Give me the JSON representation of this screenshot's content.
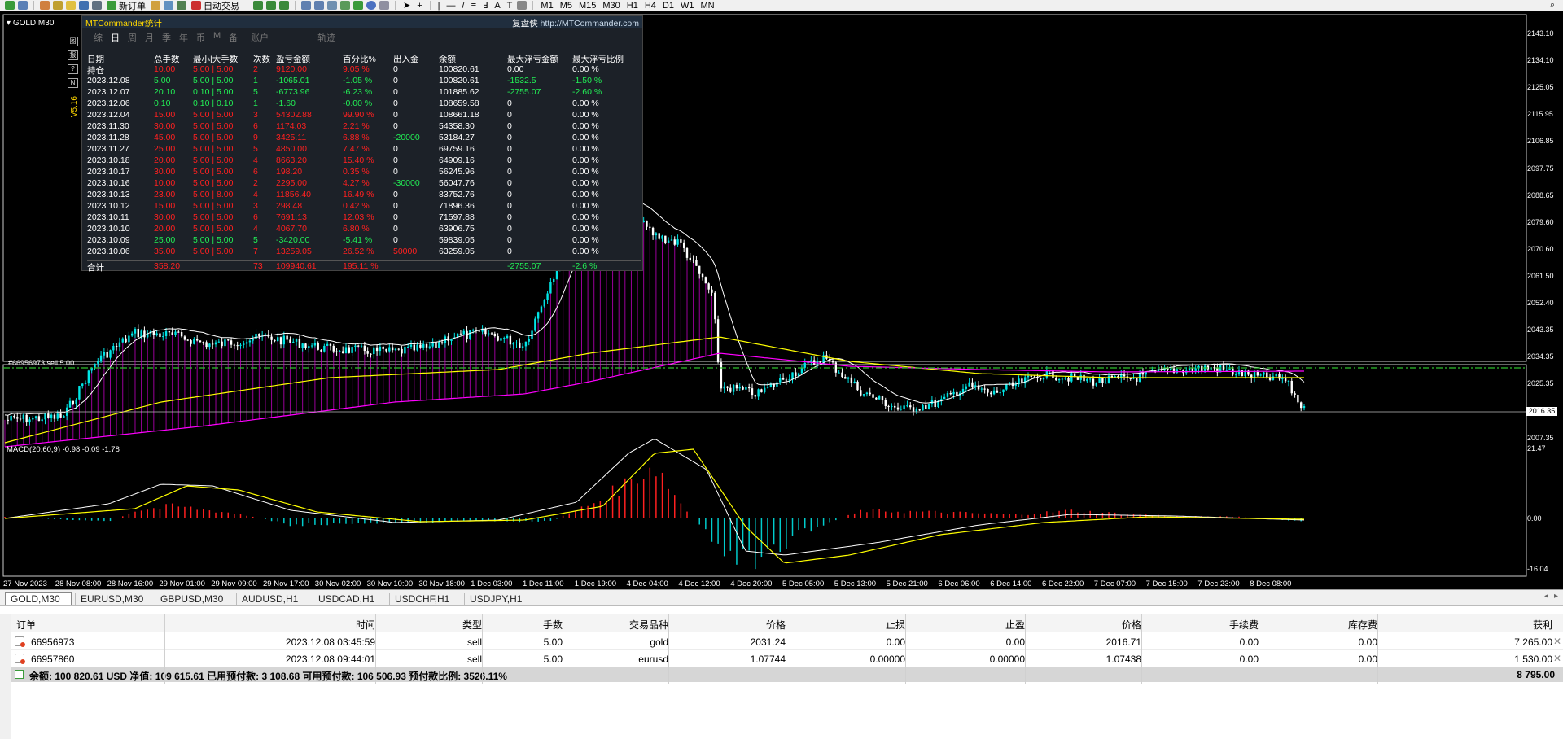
{
  "toolbar": {
    "new_order": "新订单",
    "auto_trade": "自动交易",
    "timeframes": [
      "M1",
      "M5",
      "M15",
      "M30",
      "H1",
      "H4",
      "D1",
      "W1",
      "MN"
    ]
  },
  "chart": {
    "symbol_label": "GOLD,M30",
    "order_line_label": "#66956973 sell 5.00",
    "macd_label": "MACD(20,60,9) -0.98 -0.09 -1.78",
    "price_axis": [
      "2143.10",
      "2134.10",
      "2125.05",
      "2115.95",
      "2106.85",
      "2097.75",
      "2088.65",
      "2079.60",
      "2070.60",
      "2061.50",
      "2052.40",
      "2043.35",
      "2034.35",
      "2025.35",
      "2016.35",
      "2007.35"
    ],
    "current_price": "2016.35",
    "macd_axis": [
      "21.47",
      "0.00",
      "-16.04"
    ],
    "time_axis": [
      "27 Nov 2023",
      "28 Nov 08:00",
      "28 Nov 16:00",
      "29 Nov 01:00",
      "29 Nov 09:00",
      "29 Nov 17:00",
      "30 Nov 02:00",
      "30 Nov 10:00",
      "30 Nov 18:00",
      "1 Dec 03:00",
      "1 Dec 11:00",
      "1 Dec 19:00",
      "4 Dec 04:00",
      "4 Dec 12:00",
      "4 Dec 20:00",
      "5 Dec 05:00",
      "5 Dec 13:00",
      "5 Dec 21:00",
      "6 Dec 06:00",
      "6 Dec 14:00",
      "6 Dec 22:00",
      "7 Dec 07:00",
      "7 Dec 15:00",
      "7 Dec 23:00",
      "8 Dec 08:00"
    ],
    "version": "V5.16",
    "side_buttons": [
      "图",
      "报",
      "?",
      "N"
    ],
    "colors": {
      "bg": "#000000",
      "bull": "#00e5e5",
      "bear": "#ffffff",
      "ma_fast": "#ffffff",
      "ma_slow": "#ffff00",
      "band": "#ff00ff",
      "order_line": "#2fbf2f",
      "macd_pos": "#ff2020",
      "macd_neg": "#00cccc"
    }
  },
  "stats": {
    "title": "MTCommander统计",
    "link_prefix": "复盘侠",
    "link": "http://MTCommander.com",
    "periods": [
      "综",
      "日",
      "周",
      "月",
      "季",
      "年",
      "币",
      "M",
      "备",
      "账户",
      "轨迹"
    ],
    "headers": [
      "日期",
      "总手数",
      "最小|大手数",
      "次数",
      "盈亏金额",
      "百分比%",
      "出入金",
      "余额",
      "最大浮亏金额",
      "最大浮亏比例"
    ],
    "rows": [
      [
        "持仓",
        "10.00",
        "5.00 | 5.00",
        "2",
        "9120.00",
        "9.05 %",
        "0",
        "100820.61",
        "0.00",
        "0.00 %",
        "r"
      ],
      [
        "2023.12.08",
        "5.00",
        "5.00 | 5.00",
        "1",
        "-1065.01",
        "-1.05 %",
        "0",
        "100820.61",
        "-1532.5",
        "-1.50 %",
        "g"
      ],
      [
        "2023.12.07",
        "20.10",
        "0.10 | 5.00",
        "5",
        "-6773.96",
        "-6.23 %",
        "0",
        "101885.62",
        "-2755.07",
        "-2.60 %",
        "g"
      ],
      [
        "2023.12.06",
        "0.10",
        "0.10 | 0.10",
        "1",
        "-1.60",
        "-0.00 %",
        "0",
        "108659.58",
        "0",
        "0.00 %",
        "g"
      ],
      [
        "2023.12.04",
        "15.00",
        "5.00 | 5.00",
        "3",
        "54302.88",
        "99.90 %",
        "0",
        "108661.18",
        "0",
        "0.00 %",
        "r"
      ],
      [
        "2023.11.30",
        "30.00",
        "5.00 | 5.00",
        "6",
        "1174.03",
        "2.21 %",
        "0",
        "54358.30",
        "0",
        "0.00 %",
        "r"
      ],
      [
        "2023.11.28",
        "45.00",
        "5.00 | 5.00",
        "9",
        "3425.11",
        "6.88 %",
        "-20000",
        "53184.27",
        "0",
        "0.00 %",
        "r"
      ],
      [
        "2023.11.27",
        "25.00",
        "5.00 | 5.00",
        "5",
        "4850.00",
        "7.47 %",
        "0",
        "69759.16",
        "0",
        "0.00 %",
        "r"
      ],
      [
        "2023.10.18",
        "20.00",
        "5.00 | 5.00",
        "4",
        "8663.20",
        "15.40 %",
        "0",
        "64909.16",
        "0",
        "0.00 %",
        "r"
      ],
      [
        "2023.10.17",
        "30.00",
        "5.00 | 5.00",
        "6",
        "198.20",
        "0.35 %",
        "0",
        "56245.96",
        "0",
        "0.00 %",
        "r"
      ],
      [
        "2023.10.16",
        "10.00",
        "5.00 | 5.00",
        "2",
        "2295.00",
        "4.27 %",
        "-30000",
        "56047.76",
        "0",
        "0.00 %",
        "r"
      ],
      [
        "2023.10.13",
        "23.00",
        "5.00 | 8.00",
        "4",
        "11856.40",
        "16.49 %",
        "0",
        "83752.76",
        "0",
        "0.00 %",
        "r"
      ],
      [
        "2023.10.12",
        "15.00",
        "5.00 | 5.00",
        "3",
        "298.48",
        "0.42 %",
        "0",
        "71896.36",
        "0",
        "0.00 %",
        "r"
      ],
      [
        "2023.10.11",
        "30.00",
        "5.00 | 5.00",
        "6",
        "7691.13",
        "12.03 %",
        "0",
        "71597.88",
        "0",
        "0.00 %",
        "r"
      ],
      [
        "2023.10.10",
        "20.00",
        "5.00 | 5.00",
        "4",
        "4067.70",
        "6.80 %",
        "0",
        "63906.75",
        "0",
        "0.00 %",
        "r"
      ],
      [
        "2023.10.09",
        "25.00",
        "5.00 | 5.00",
        "5",
        "-3420.00",
        "-5.41 %",
        "0",
        "59839.05",
        "0",
        "0.00 %",
        "g"
      ],
      [
        "2023.10.06",
        "35.00",
        "5.00 | 5.00",
        "7",
        "13259.05",
        "26.52 %",
        "50000",
        "63259.05",
        "0",
        "0.00 %",
        "r"
      ]
    ],
    "total": {
      "label": "合计",
      "lots": "358.20",
      "count": "73",
      "pnl": "109940.61",
      "pct": "195.11 %",
      "max_float": "-2755.07",
      "max_float_pct": "-2.6 %"
    }
  },
  "chart_tabs": [
    "GOLD,M30",
    "EURUSD,M30",
    "GBPUSD,M30",
    "AUDUSD,H1",
    "USDCAD,H1",
    "USDCHF,H1",
    "USDJPY,H1"
  ],
  "orders": {
    "headers": [
      "订单",
      "时间",
      "类型",
      "手数",
      "交易品种",
      "价格",
      "止损",
      "止盈",
      "价格",
      "手续费",
      "库存费",
      "获利"
    ],
    "rows": [
      [
        "66956973",
        "2023.12.08 03:45:59",
        "sell",
        "5.00",
        "gold",
        "2031.24",
        "0.00",
        "0.00",
        "2016.71",
        "0.00",
        "0.00",
        "7 265.00"
      ],
      [
        "66957860",
        "2023.12.08 09:44:01",
        "sell",
        "5.00",
        "eurusd",
        "1.07744",
        "0.00000",
        "0.00000",
        "1.07438",
        "0.00",
        "0.00",
        "1 530.00"
      ]
    ],
    "balance": "余额: 100 820.61 USD  净值: 109 615.61  已用预付款: 3 108.68  可用预付款: 106 506.93  预付款比例: 3526.11%",
    "total_profit": "8 795.00"
  }
}
